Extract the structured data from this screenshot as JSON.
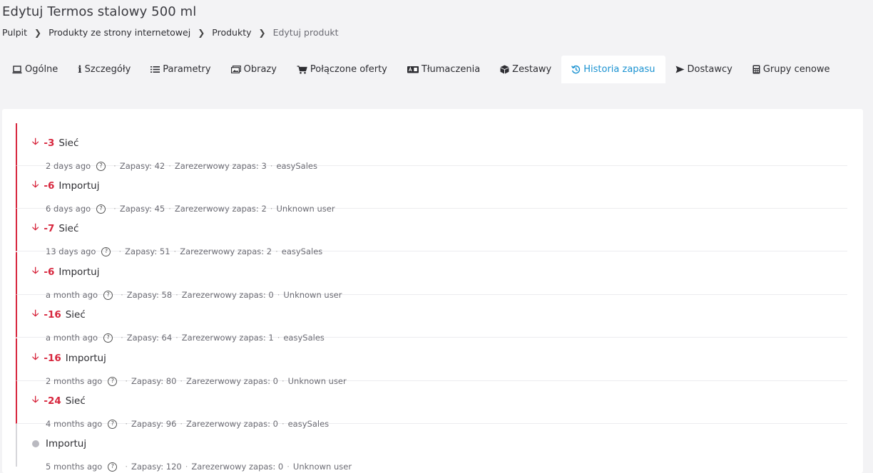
{
  "page": {
    "title": "Edytuj Termos stalowy 500 ml"
  },
  "breadcrumb": [
    "Pulpit",
    "Produkty ze strony internetowej",
    "Produkty",
    "Edytuj produkt"
  ],
  "tabs": [
    {
      "label": "Ogólne",
      "icon": "laptop-icon"
    },
    {
      "label": "Szczegóły",
      "icon": "info-icon"
    },
    {
      "label": "Parametry",
      "icon": "list-icon"
    },
    {
      "label": "Obrazy",
      "icon": "images-icon"
    },
    {
      "label": "Połączone oferty",
      "icon": "cart-icon"
    },
    {
      "label": "Tłumaczenia",
      "icon": "language-icon"
    },
    {
      "label": "Zestawy",
      "icon": "box-icon"
    },
    {
      "label": "Historia zapasu",
      "icon": "history-icon",
      "active": true
    },
    {
      "label": "Dostawcy",
      "icon": "send-icon"
    },
    {
      "label": "Grupy cenowe",
      "icon": "calculator-icon"
    }
  ],
  "history": [
    {
      "delta": "-3",
      "action": "Sieć",
      "time": "2 days ago",
      "stock": "Zapasy: 42",
      "reserved": "Zarezerwowy zapas: 3",
      "user": "easySales"
    },
    {
      "delta": "-6",
      "action": "Importuj",
      "time": "6 days ago",
      "stock": "Zapasy: 45",
      "reserved": "Zarezerwowy zapas: 2",
      "user": "Unknown user"
    },
    {
      "delta": "-7",
      "action": "Sieć",
      "time": "13 days ago",
      "stock": "Zapasy: 51",
      "reserved": "Zarezerwowy zapas: 2",
      "user": "easySales"
    },
    {
      "delta": "-6",
      "action": "Importuj",
      "time": "a month ago",
      "stock": "Zapasy: 58",
      "reserved": "Zarezerwowy zapas: 0",
      "user": "Unknown user"
    },
    {
      "delta": "-16",
      "action": "Sieć",
      "time": "a month ago",
      "stock": "Zapasy: 64",
      "reserved": "Zarezerwowy zapas: 1",
      "user": "easySales"
    },
    {
      "delta": "-16",
      "action": "Importuj",
      "time": "2 months ago",
      "stock": "Zapasy: 80",
      "reserved": "Zarezerwowy zapas: 0",
      "user": "Unknown user"
    },
    {
      "delta": "-24",
      "action": "Sieć",
      "time": "4 months ago",
      "stock": "Zapasy: 96",
      "reserved": "Zarezerwowy zapas: 0",
      "user": "easySales"
    },
    {
      "delta": "",
      "action": "Importuj",
      "time": "5 months ago",
      "stock": "Zapasy: 120",
      "reserved": "Zarezerwowy zapas: 0",
      "user": "Unknown user"
    }
  ],
  "colors": {
    "accent": "#1a92d1",
    "negative": "#d7263d",
    "neutral_dot": "#b9b9c0"
  }
}
